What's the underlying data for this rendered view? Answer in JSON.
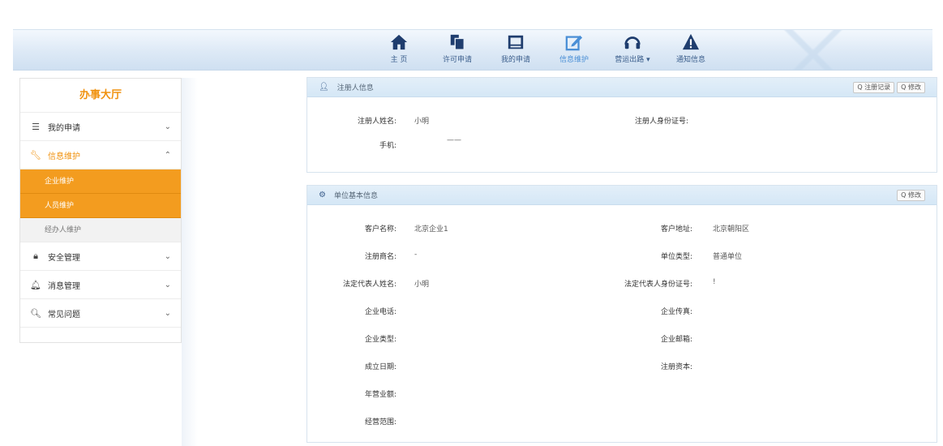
{
  "nav": {
    "items": [
      {
        "label": "主 页",
        "icon": "home-icon"
      },
      {
        "label": "许可申请",
        "icon": "documents-icon"
      },
      {
        "label": "我的申请",
        "icon": "list-icon"
      },
      {
        "label": "信息维护",
        "icon": "edit-icon",
        "active": true
      },
      {
        "label": "营运出路 ▾",
        "icon": "headset-icon"
      },
      {
        "label": "通知信息",
        "icon": "warning-icon"
      }
    ]
  },
  "sidebar": {
    "title": "办事大厅",
    "items": [
      {
        "label": "我的申请",
        "icon": "list-icon",
        "chevron": "⌄"
      },
      {
        "label": "信息维护",
        "icon": "wrench-icon",
        "chevron": "⌃"
      }
    ],
    "sub_items": [
      "企业维护",
      "人员维护",
      "经办人维护"
    ],
    "items_after": [
      {
        "label": "安全管理",
        "icon": "lock-icon",
        "chevron": "⌄"
      },
      {
        "label": "消息管理",
        "icon": "bell-icon",
        "chevron": "⌄"
      },
      {
        "label": "常见问题",
        "icon": "search-icon",
        "chevron": "⌄"
      }
    ]
  },
  "panel1": {
    "title": "注册人信息",
    "buttons": [
      "Q 注册记录",
      "Q 修改"
    ],
    "fields": {
      "name_label": "注册人姓名:",
      "name_value": "小明",
      "id_label": "注册人身份证号:",
      "id_value": "",
      "phone_label": "手机:",
      "phone_value": "——"
    }
  },
  "panel2": {
    "title": "单位基本信息",
    "buttons": [
      "Q 修改"
    ],
    "fields": [
      {
        "label": "客户名称:",
        "value": "北京企业1",
        "label2": "客户地址:",
        "value2": "北京朝阳区"
      },
      {
        "label": "注册商名:",
        "value": "-",
        "label2": "单位类型:",
        "value2": "普通单位"
      },
      {
        "label": "法定代表人姓名:",
        "value": "小明",
        "label2": "法定代表人身份证号:",
        "value2": "!"
      },
      {
        "label": "企业电话:",
        "value": "",
        "label2": "企业传真:",
        "value2": ""
      },
      {
        "label": "企业类型:",
        "value": "",
        "label2": "企业邮箱:",
        "value2": ""
      },
      {
        "label": "成立日期:",
        "value": "",
        "label2": "注册资本:",
        "value2": ""
      },
      {
        "label": "年营业额:",
        "value": "",
        "label2": "",
        "value2": ""
      },
      {
        "label": "经营范围:",
        "value": "",
        "label2": "",
        "value2": ""
      }
    ]
  },
  "colors": {
    "accent": "#f39c1f",
    "nav_icon": "#1f3d6e",
    "nav_active": "#4a8fd6"
  }
}
